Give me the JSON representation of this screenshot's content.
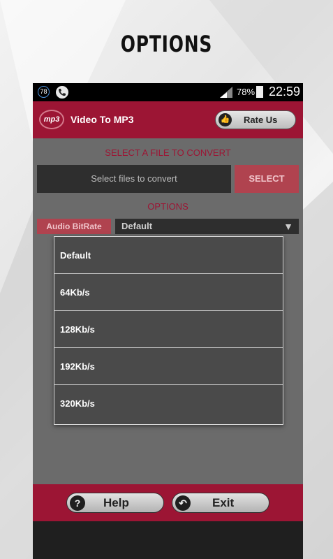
{
  "promo": {
    "title": "OPTIONS"
  },
  "status_bar": {
    "notification_count": "78",
    "battery": "78%",
    "time": "22:59"
  },
  "app_bar": {
    "logo_text": "mp3",
    "title": "Video To MP3",
    "rate_us_label": "Rate Us"
  },
  "convert": {
    "section_label": "SELECT A FILE TO CONVERT",
    "file_placeholder": "Select files to convert",
    "select_button": "SELECT"
  },
  "options": {
    "section_label": "OPTIONS",
    "bitrate_label": "Audio BitRate",
    "bitrate_value": "Default",
    "bitrate_options": [
      "Default",
      "64Kb/s",
      "128Kb/s",
      "192Kb/s",
      "320Kb/s"
    ]
  },
  "footer": {
    "help_label": "Help",
    "exit_label": "Exit"
  },
  "colors": {
    "accent": "#9c1534",
    "button_pink": "#b0434f",
    "dark_field": "#2e2e2e"
  }
}
